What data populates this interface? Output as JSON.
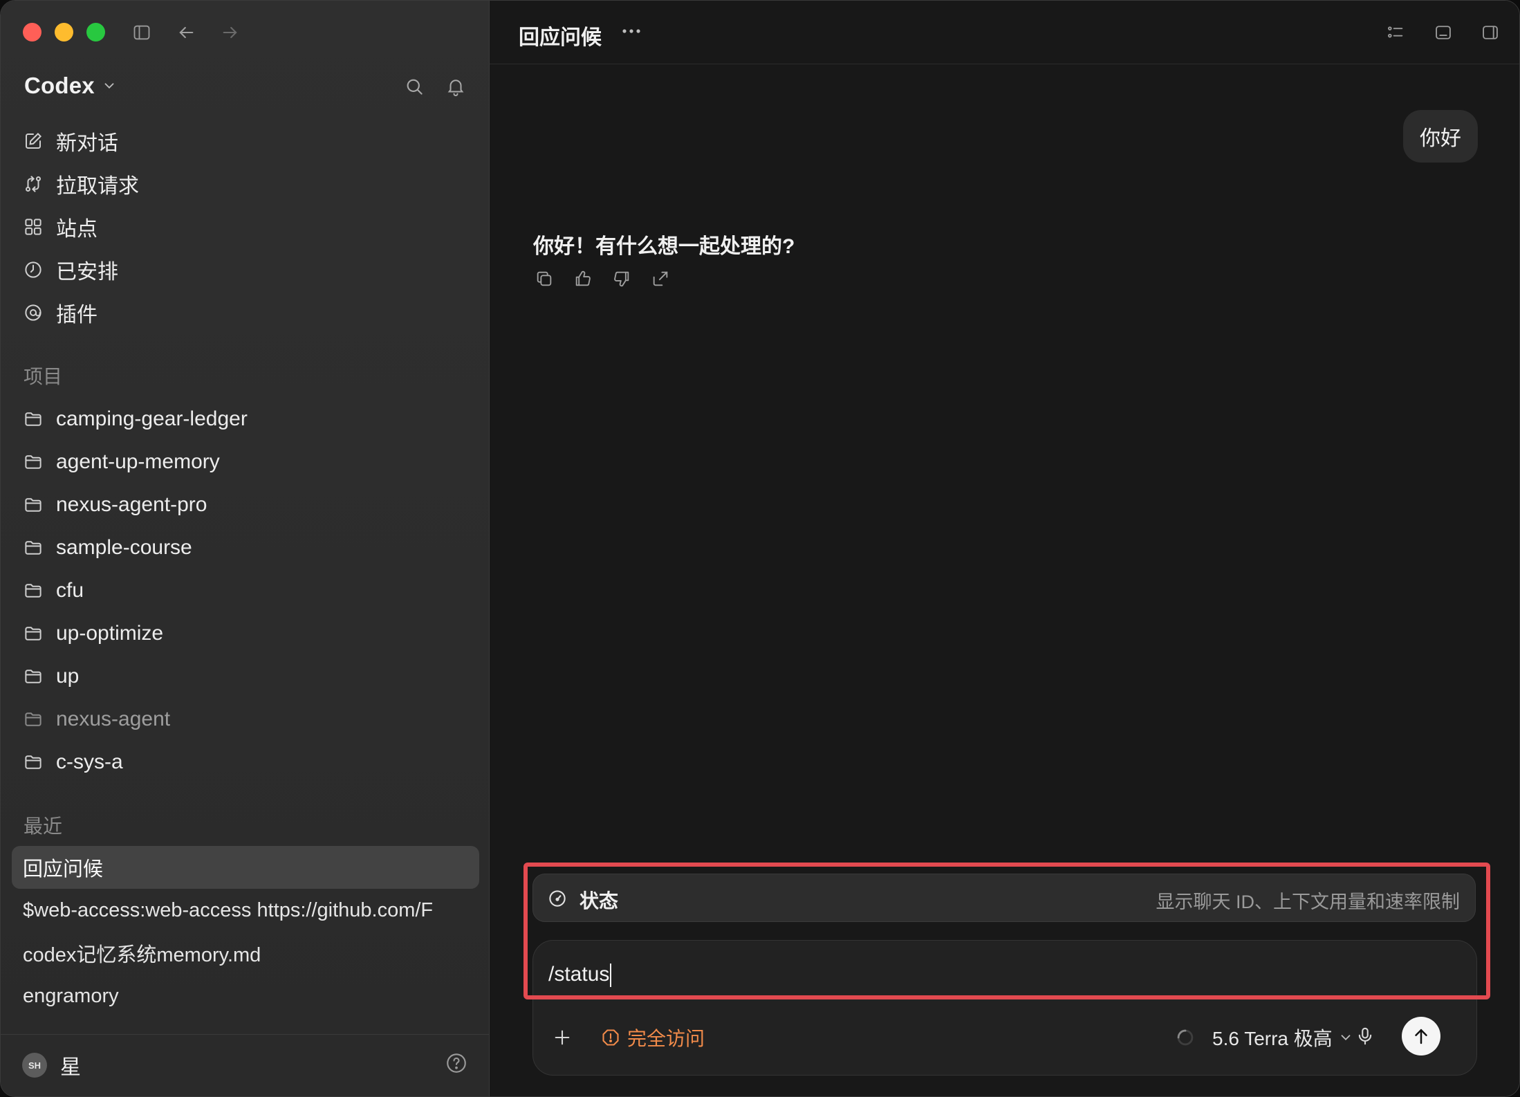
{
  "sidebar": {
    "brand": "Codex",
    "nav": [
      {
        "label": "新对话",
        "icon": "edit-icon"
      },
      {
        "label": "拉取请求",
        "icon": "pull-request-icon"
      },
      {
        "label": "站点",
        "icon": "grid-icon"
      },
      {
        "label": "已安排",
        "icon": "clock-icon"
      },
      {
        "label": "插件",
        "icon": "at-icon"
      }
    ],
    "projects_label": "项目",
    "projects": [
      "camping-gear-ledger",
      "agent-up-memory",
      "nexus-agent-pro",
      "sample-course",
      "cfu",
      "up-optimize",
      "up",
      "nexus-agent",
      "c-sys-a"
    ],
    "recent_label": "最近",
    "recent": [
      "回应问候",
      "$web-access:web-access https://github.com/F",
      "codex记忆系统memory.md",
      "engramory"
    ],
    "user": {
      "initials": "SH",
      "name": "星"
    }
  },
  "main": {
    "title": "回应问候",
    "messages": {
      "user": "你好",
      "assistant": "你好！有什么想一起处理的?"
    },
    "command": {
      "label": "状态",
      "description": "显示聊天 ID、上下文用量和速率限制"
    },
    "composer": {
      "value": "/status",
      "access_label": "完全访问",
      "model_label": "5.6 Terra 极高"
    }
  },
  "colors": {
    "accent_orange": "#f28b4a",
    "highlight_red": "#e34a50",
    "sidebar_bg": "#2f2f2f",
    "main_bg": "#181818"
  }
}
